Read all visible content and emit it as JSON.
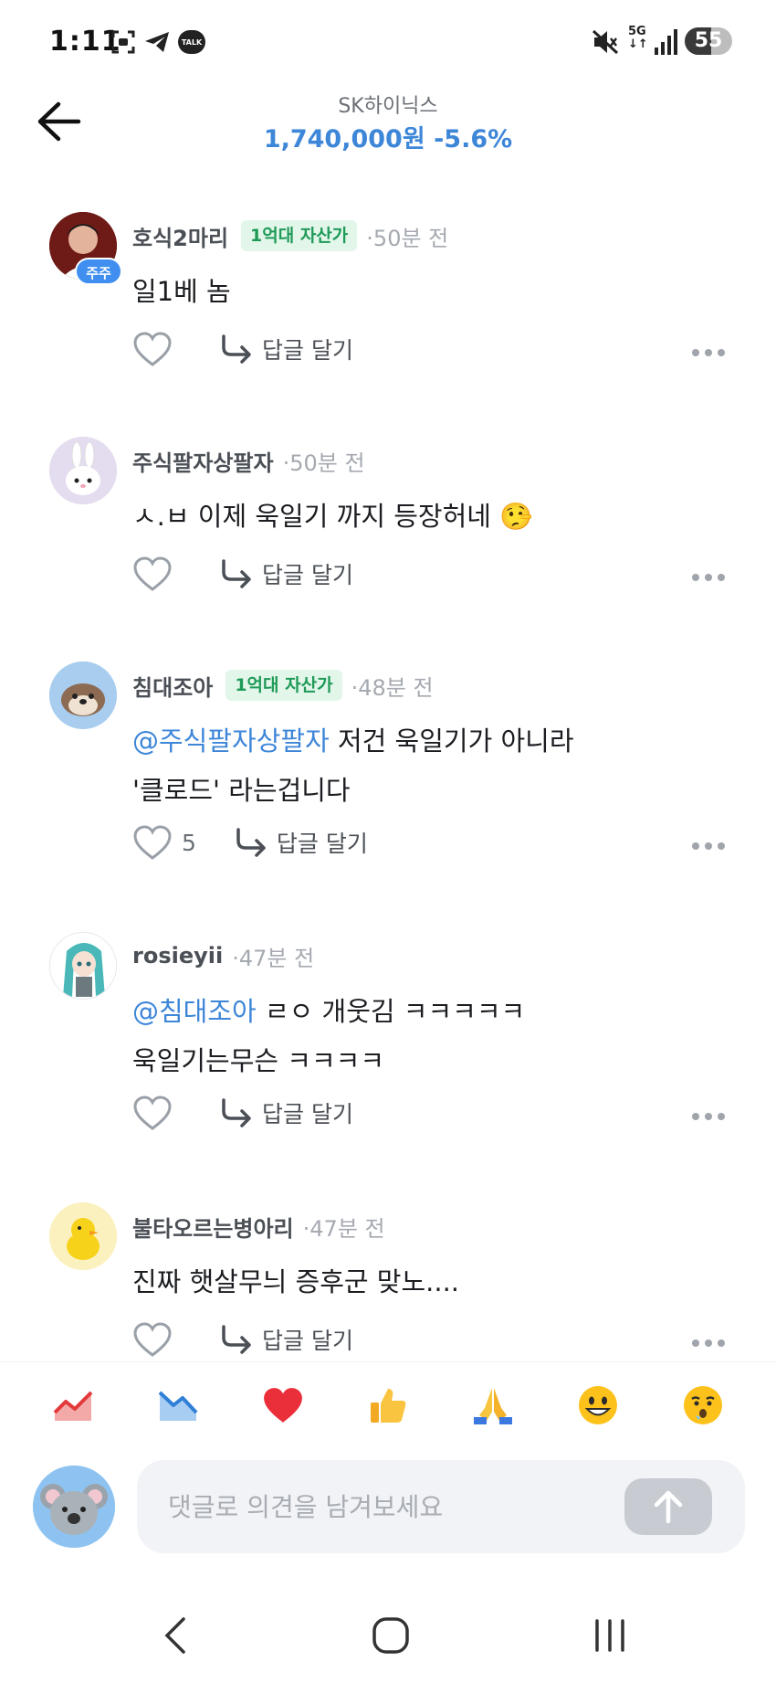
{
  "status_bar": {
    "time": "1:11",
    "network": "5G",
    "battery": "55",
    "battery_level_pct": 55,
    "icons": [
      "screenshot-icon",
      "telegram-icon",
      "kakaotalk-icon",
      "mute-icon",
      "5g-icon",
      "signal-icon",
      "battery-icon"
    ],
    "talk_label": "TALK"
  },
  "header": {
    "title": "SK하이닉스",
    "price": "1,740,000원",
    "change": "-5.6%",
    "accent_color": "#3d86d8"
  },
  "comments": [
    {
      "nickname": "호식2마리",
      "holder_badge": "주주",
      "tag": "1억대 자산가",
      "time": "50분 전",
      "mention": "",
      "lines": [
        "일1베 놈"
      ],
      "likes": "",
      "reply_label": "답글 달기"
    },
    {
      "nickname": "주식팔자상팔자",
      "holder_badge": "",
      "tag": "",
      "time": "50분 전",
      "mention": "",
      "lines": [
        "ㅅ.ㅂ 이제 욱일기 까지 등장허네 🤥"
      ],
      "likes": "",
      "reply_label": "답글 달기"
    },
    {
      "nickname": "침대조아",
      "holder_badge": "",
      "tag": "1억대 자산가",
      "time": "48분 전",
      "mention": "@주식팔자상팔자",
      "lines": [
        " 저건 욱일기가 아니라",
        "'클로드' 라는겁니다"
      ],
      "likes": "5",
      "reply_label": "답글 달기"
    },
    {
      "nickname": "rosieyii",
      "holder_badge": "",
      "tag": "",
      "time": "47분 전",
      "mention": "@침대조아",
      "lines": [
        " ㄹㅇ 개웃김 ㅋㅋㅋㅋㅋ",
        "욱일기는무슨 ㅋㅋㅋㅋ"
      ],
      "likes": "",
      "reply_label": "답글 달기"
    },
    {
      "nickname": "불타오르는병아리",
      "holder_badge": "",
      "tag": "",
      "time": "47분 전",
      "mention": "",
      "lines": [
        "진짜 햇살무늬 증후군 맞노...."
      ],
      "likes": "",
      "reply_label": "답글 달기"
    }
  ],
  "reactions": [
    "chart-up-icon",
    "chart-down-icon",
    "heart-icon",
    "thumbs-up-icon",
    "pray-icon",
    "smile-icon",
    "lying-face-icon"
  ],
  "composer": {
    "placeholder": "댓글로 의견을 남겨보세요",
    "value": ""
  },
  "nav": [
    "back-nav-icon",
    "home-nav-icon",
    "recents-nav-icon"
  ]
}
